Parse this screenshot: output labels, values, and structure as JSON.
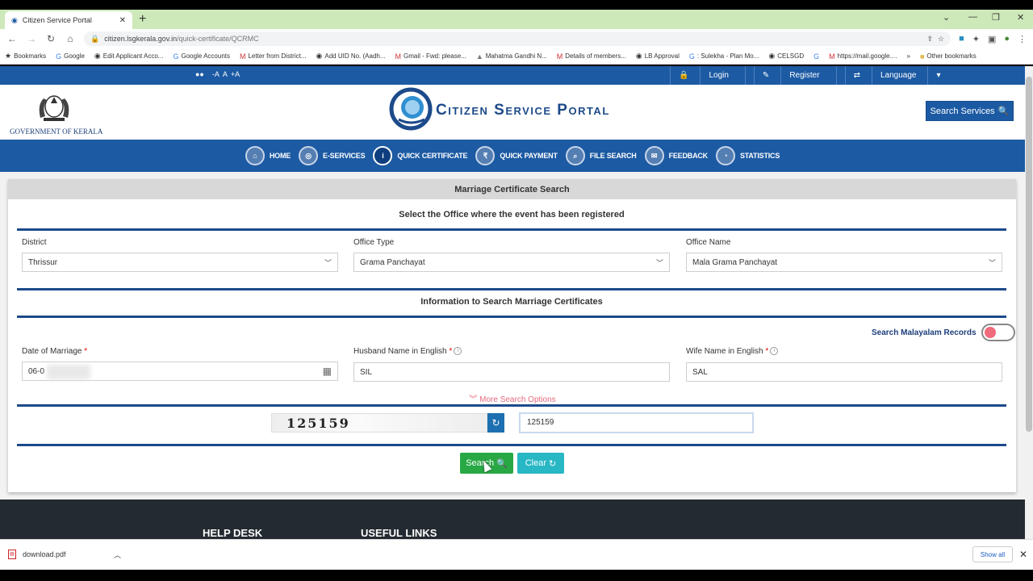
{
  "browser": {
    "tab_title": "Citizen Service Portal",
    "tab_close": "✕",
    "new_tab": "+",
    "window_controls": [
      "⌄",
      "—",
      "❐",
      "✕"
    ],
    "url_host": "citizen.lsgkerala.gov.in",
    "url_path": "/quick-certificate/QCRMC",
    "bookmarks": [
      "Bookmarks",
      "Google",
      "Edit Applicant Acco...",
      "Google Accounts",
      "Letter from District...",
      "Add UID No. (Aadh...",
      "Gmail - Fwd: please...",
      "Mahatma Gandhi N...",
      "Details of members...",
      "LB Approval",
      ": Sulekha - Plan Mo...",
      "CELSGD",
      "https://mail.google....",
      "»",
      "Other bookmarks"
    ]
  },
  "topbar": {
    "font_controls": [
      "-A",
      "A",
      "+A"
    ],
    "login": "Login",
    "register": "Register",
    "language": "Language"
  },
  "header": {
    "gov_label": "GOVERNMENT OF KERALA",
    "portal_title": "Citizen Service Portal",
    "search_services": "Search Services"
  },
  "nav": {
    "items": [
      "HOME",
      "E-SERVICES",
      "QUICK CERTIFICATE",
      "QUICK PAYMENT",
      "FILE SEARCH",
      "FEEDBACK",
      "STATISTICS"
    ],
    "active": "QUICK CERTIFICATE"
  },
  "form": {
    "card_title": "Marriage Certificate Search",
    "office_section_title": "Select the Office where the event has been registered",
    "district_label": "District",
    "district_value": "Thrissur",
    "office_type_label": "Office Type",
    "office_type_value": "Grama Panchayat",
    "office_name_label": "Office Name",
    "office_name_value": "Mala Grama Panchayat",
    "info_section_title": "Information to Search Marriage Certificates",
    "malayalam_toggle_label": "Search Malayalam Records",
    "malayalam_toggle_on": false,
    "date_label": "Date of Marriage",
    "date_value": "06-0",
    "husband_label": "Husband Name in English",
    "husband_value": "SIL",
    "wife_label": "Wife Name in English",
    "wife_value": "SAL",
    "required_mark": "*",
    "more_options": "More Search Options",
    "captcha_text": "125159",
    "captcha_input_value": "125159",
    "search_button": "Search",
    "clear_button": "Clear"
  },
  "footer": {
    "help_desk": "HELP DESK",
    "useful_links": "USEFUL LINKS"
  },
  "downloads": {
    "file": "download.pdf",
    "show_all": "Show all"
  },
  "colors": {
    "primary_blue": "#1c5aa3",
    "search_green": "#27a844",
    "clear_teal": "#28b7c4",
    "toggle_pink": "#f06b7b"
  }
}
